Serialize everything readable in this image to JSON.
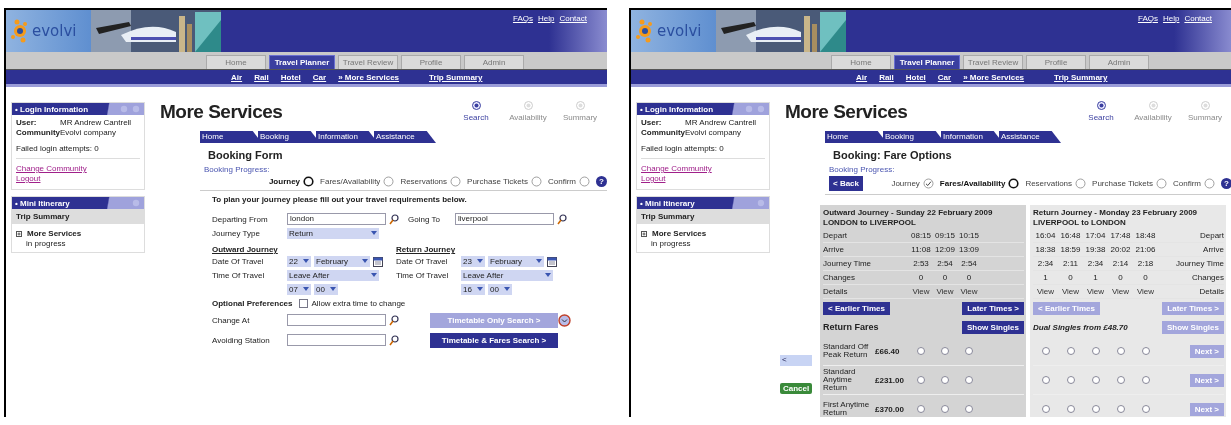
{
  "panels": [
    {
      "kind": "booking_form",
      "logo": "evolvi",
      "header_links": [
        "FAQs",
        "Help",
        "Contact"
      ],
      "nav_tabs": [
        {
          "label": "Home",
          "selected": false
        },
        {
          "label": "Travel Planner",
          "selected": true
        },
        {
          "label": "Travel Review",
          "selected": false
        },
        {
          "label": "Profile",
          "selected": false
        },
        {
          "label": "Admin",
          "selected": false
        }
      ],
      "sub_nav": [
        "Air",
        "Rail",
        "Hotel",
        "Car",
        "» More Services",
        "Trip Summary"
      ],
      "login_box": {
        "title": "• Login Information",
        "fields": [
          {
            "label": "User:",
            "value": "MR Andrew Cantrell"
          },
          {
            "label": "Community",
            "value": "Evolvi company"
          }
        ],
        "failed": "Failed login attempts: 0",
        "links": [
          "Change Community",
          "Logout"
        ]
      },
      "itinerary_box": {
        "title": "• Mini Itinerary",
        "heading": "Trip Summary",
        "item": "More Services",
        "status": "in progress"
      },
      "title": "More Services",
      "wizard": [
        {
          "label": "Search",
          "selected": true
        },
        {
          "label": "Availability",
          "selected": false
        },
        {
          "label": "Summary",
          "selected": false
        }
      ],
      "booking_tabs": [
        "Home",
        "Booking",
        "Information",
        "Assistance"
      ],
      "form_title": "Booking Form",
      "progress_label": "Booking Progress:",
      "help": "?",
      "progress": [
        {
          "label": "Journey",
          "selected": true,
          "done": false
        },
        {
          "label": "Fares/Availability",
          "selected": false,
          "done": false
        },
        {
          "label": "Reservations",
          "selected": false,
          "done": false
        },
        {
          "label": "Purchase Tickets",
          "selected": false,
          "done": false
        },
        {
          "label": "Confirm",
          "selected": false,
          "done": false
        }
      ],
      "intro": "To plan your journey please fill out your travel requirements below.",
      "departing": {
        "label": "Departing From",
        "value": "london"
      },
      "going": {
        "label": "Going To",
        "value": "liverpool"
      },
      "journey_type": {
        "label": "Journey Type",
        "value": "Return"
      },
      "journeys": [
        {
          "heading": "Outward Journey",
          "date_label": "Date Of Travel",
          "day": "22",
          "month": "February",
          "time_label": "Time Of Travel",
          "time_mode": "Leave After",
          "hour": "07",
          "minute": "00"
        },
        {
          "heading": "Return Journey",
          "date_label": "Date Of Travel",
          "day": "23",
          "month": "February",
          "time_label": "Time Of Travel",
          "time_mode": "Leave After",
          "hour": "16",
          "minute": "00"
        }
      ],
      "optional": {
        "label": "Optional Preferences",
        "option": "Allow extra time to change",
        "checked": false
      },
      "stations": [
        {
          "label": "Change At"
        },
        {
          "label": "Avoiding Station"
        }
      ],
      "buttons": [
        {
          "label": "Timetable Only Search >",
          "disabled": true
        },
        {
          "label": "Timetable & Fares Search >",
          "disabled": false
        }
      ]
    },
    {
      "kind": "fare_options",
      "logo": "evolvi",
      "header_links": [
        "FAQs",
        "Help",
        "Contact"
      ],
      "nav_tabs": [
        {
          "label": "Home",
          "selected": false
        },
        {
          "label": "Travel Planner",
          "selected": true
        },
        {
          "label": "Travel Review",
          "selected": false
        },
        {
          "label": "Profile",
          "selected": false
        },
        {
          "label": "Admin",
          "selected": false
        }
      ],
      "sub_nav": [
        "Air",
        "Rail",
        "Hotel",
        "Car",
        "» More Services",
        "Trip Summary"
      ],
      "login_box": {
        "title": "• Login Information",
        "fields": [
          {
            "label": "User:",
            "value": "MR Andrew Cantrell"
          },
          {
            "label": "Community",
            "value": "Evolvi company"
          }
        ],
        "failed": "Failed login attempts: 0",
        "links": [
          "Change Community",
          "Logout"
        ]
      },
      "itinerary_box": {
        "title": "• Mini Itinerary",
        "heading": "Trip Summary",
        "item": "More Services",
        "status": "in progress"
      },
      "title": "More Services",
      "wizard": [
        {
          "label": "Search",
          "selected": true
        },
        {
          "label": "Availability",
          "selected": false
        },
        {
          "label": "Summary",
          "selected": false
        }
      ],
      "booking_tabs": [
        "Home",
        "Booking",
        "Information",
        "Assistance"
      ],
      "form_title": "Booking: Fare Options",
      "progress_label": "Booking Progress:",
      "help": "?",
      "back": "< Back",
      "progress": [
        {
          "label": "Journey",
          "selected": false,
          "done": true
        },
        {
          "label": "Fares/Availability",
          "selected": true,
          "done": false
        },
        {
          "label": "Reservations",
          "selected": false,
          "done": false
        },
        {
          "label": "Purchase Tickets",
          "selected": false,
          "done": false
        },
        {
          "label": "Confirm",
          "selected": false,
          "done": false
        }
      ],
      "side_back": "<",
      "cancel": "Cancel",
      "tables": [
        {
          "kind": "labels_left",
          "title": "Outward Journey - Sunday 22 February 2009",
          "route": "LONDON to LIVERPOOL",
          "rows": [
            {
              "label": "Depart",
              "cells": [
                "08:15",
                "09:15",
                "10:15"
              ]
            },
            {
              "label": "Arrive",
              "cells": [
                "11:08",
                "12:09",
                "13:09"
              ]
            },
            {
              "label": "Journey Time",
              "cells": [
                "2:53",
                "2:54",
                "2:54"
              ]
            },
            {
              "label": "Changes",
              "cells": [
                "0",
                "0",
                "0"
              ]
            },
            {
              "label": "Details",
              "cells": [
                "View",
                "View",
                "View"
              ]
            }
          ],
          "earlier": {
            "label": "< Earlier Times",
            "disabled": false
          },
          "later": {
            "label": "Later Times >",
            "disabled": false
          },
          "fares_title": "Return Fares",
          "show_singles": {
            "label": "Show Singles",
            "disabled": false
          },
          "fares": [
            {
              "name": "Standard Off Peak Return",
              "price": "£66.40",
              "options": [
                {
                  "selected": false
                },
                {
                  "selected": false
                },
                {
                  "selected": false
                }
              ]
            },
            {
              "name": "Standard Anytime Return",
              "price": "£231.00",
              "options": [
                {
                  "selected": false
                },
                {
                  "selected": false
                },
                {
                  "selected": false
                }
              ]
            },
            {
              "name": "First Anytime Return",
              "price": "£370.00",
              "options": [
                {
                  "selected": false
                },
                {
                  "selected": false
                },
                {
                  "selected": false
                }
              ]
            }
          ]
        },
        {
          "kind": "labels_right",
          "title": "Return Journey - Monday 23 February 2009",
          "route": "LIVERPOOL to LONDON",
          "rows": [
            {
              "label": "Depart",
              "cells": [
                "16:04",
                "16:48",
                "17:04",
                "17:48",
                "18:48"
              ]
            },
            {
              "label": "Arrive",
              "cells": [
                "18:38",
                "18:59",
                "19:38",
                "20:02",
                "21:06"
              ]
            },
            {
              "label": "Journey Time",
              "cells": [
                "2:34",
                "2:11",
                "2:34",
                "2:14",
                "2:18"
              ]
            },
            {
              "label": "Changes",
              "cells": [
                "1",
                "0",
                "1",
                "0",
                "0"
              ]
            },
            {
              "label": "Details",
              "cells": [
                "View",
                "View",
                "View",
                "View",
                "View"
              ]
            }
          ],
          "earlier": {
            "label": "< Earlier Times",
            "disabled": true
          },
          "later": {
            "label": "Later Times >",
            "disabled": true
          },
          "fares_title": "Dual Singles from £48.70",
          "show_singles": {
            "label": "Show Singles",
            "disabled": true
          },
          "fares": [
            {
              "options": [
                {
                  "selected": false
                },
                {
                  "selected": false
                },
                {
                  "selected": false
                },
                {
                  "selected": false
                },
                {
                  "selected": false
                }
              ],
              "next": {
                "label": "Next >",
                "disabled": true
              }
            },
            {
              "options": [
                {
                  "selected": false
                },
                {
                  "selected": false
                },
                {
                  "selected": false
                },
                {
                  "selected": false
                },
                {
                  "selected": false
                }
              ],
              "next": {
                "label": "Next >",
                "disabled": true
              }
            },
            {
              "options": [
                {
                  "selected": false
                },
                {
                  "selected": false
                },
                {
                  "selected": false
                },
                {
                  "selected": false
                },
                {
                  "selected": false
                }
              ],
              "next": {
                "label": "Next >",
                "disabled": true
              }
            }
          ]
        }
      ]
    }
  ]
}
